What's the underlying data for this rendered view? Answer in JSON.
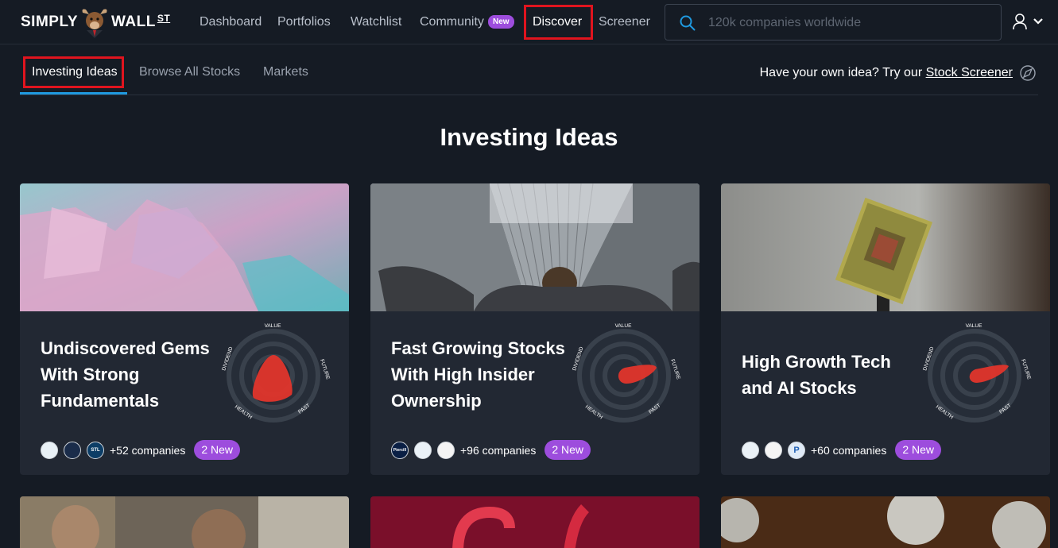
{
  "brand": {
    "left": "SIMPLY",
    "right": "WALL",
    "suffix": "ST"
  },
  "nav": {
    "items": [
      {
        "label": "Dashboard"
      },
      {
        "label": "Portfolios"
      },
      {
        "label": "Watchlist"
      },
      {
        "label": "Community"
      },
      {
        "label": "Discover"
      },
      {
        "label": "Screener"
      }
    ],
    "community_badge": "New"
  },
  "search": {
    "placeholder": "120k companies worldwide"
  },
  "subnav": {
    "tabs": [
      {
        "label": "Investing Ideas"
      },
      {
        "label": "Browse All Stocks"
      },
      {
        "label": "Markets"
      }
    ],
    "promo_text": "Have your own idea? Try our ",
    "promo_link": "Stock Screener"
  },
  "page_title": "Investing Ideas",
  "snowflake_axes": {
    "value": "VALUE",
    "future": "FUTURE",
    "past": "PAST",
    "health": "HEALTH",
    "dividend": "DIVIDEND"
  },
  "cards": [
    {
      "title": "Undiscovered Gems With Strong Fundamentals",
      "companies": "+52 companies",
      "badge": "2 New",
      "logos": [
        "",
        "",
        "STL"
      ]
    },
    {
      "title": "Fast Growing Stocks With High Insider Ownership",
      "companies": "+96 companies",
      "badge": "2 New",
      "logos": [
        "Piercill",
        "",
        ""
      ]
    },
    {
      "title": "High Growth Tech and AI Stocks",
      "companies": "+60 companies",
      "badge": "2 New",
      "logos": [
        "",
        "",
        "P"
      ]
    }
  ],
  "colors": {
    "accent": "#1f9ae0",
    "badge": "#9d4ddd",
    "highlight": "#e0141e",
    "snowflake": "#e0352b"
  }
}
